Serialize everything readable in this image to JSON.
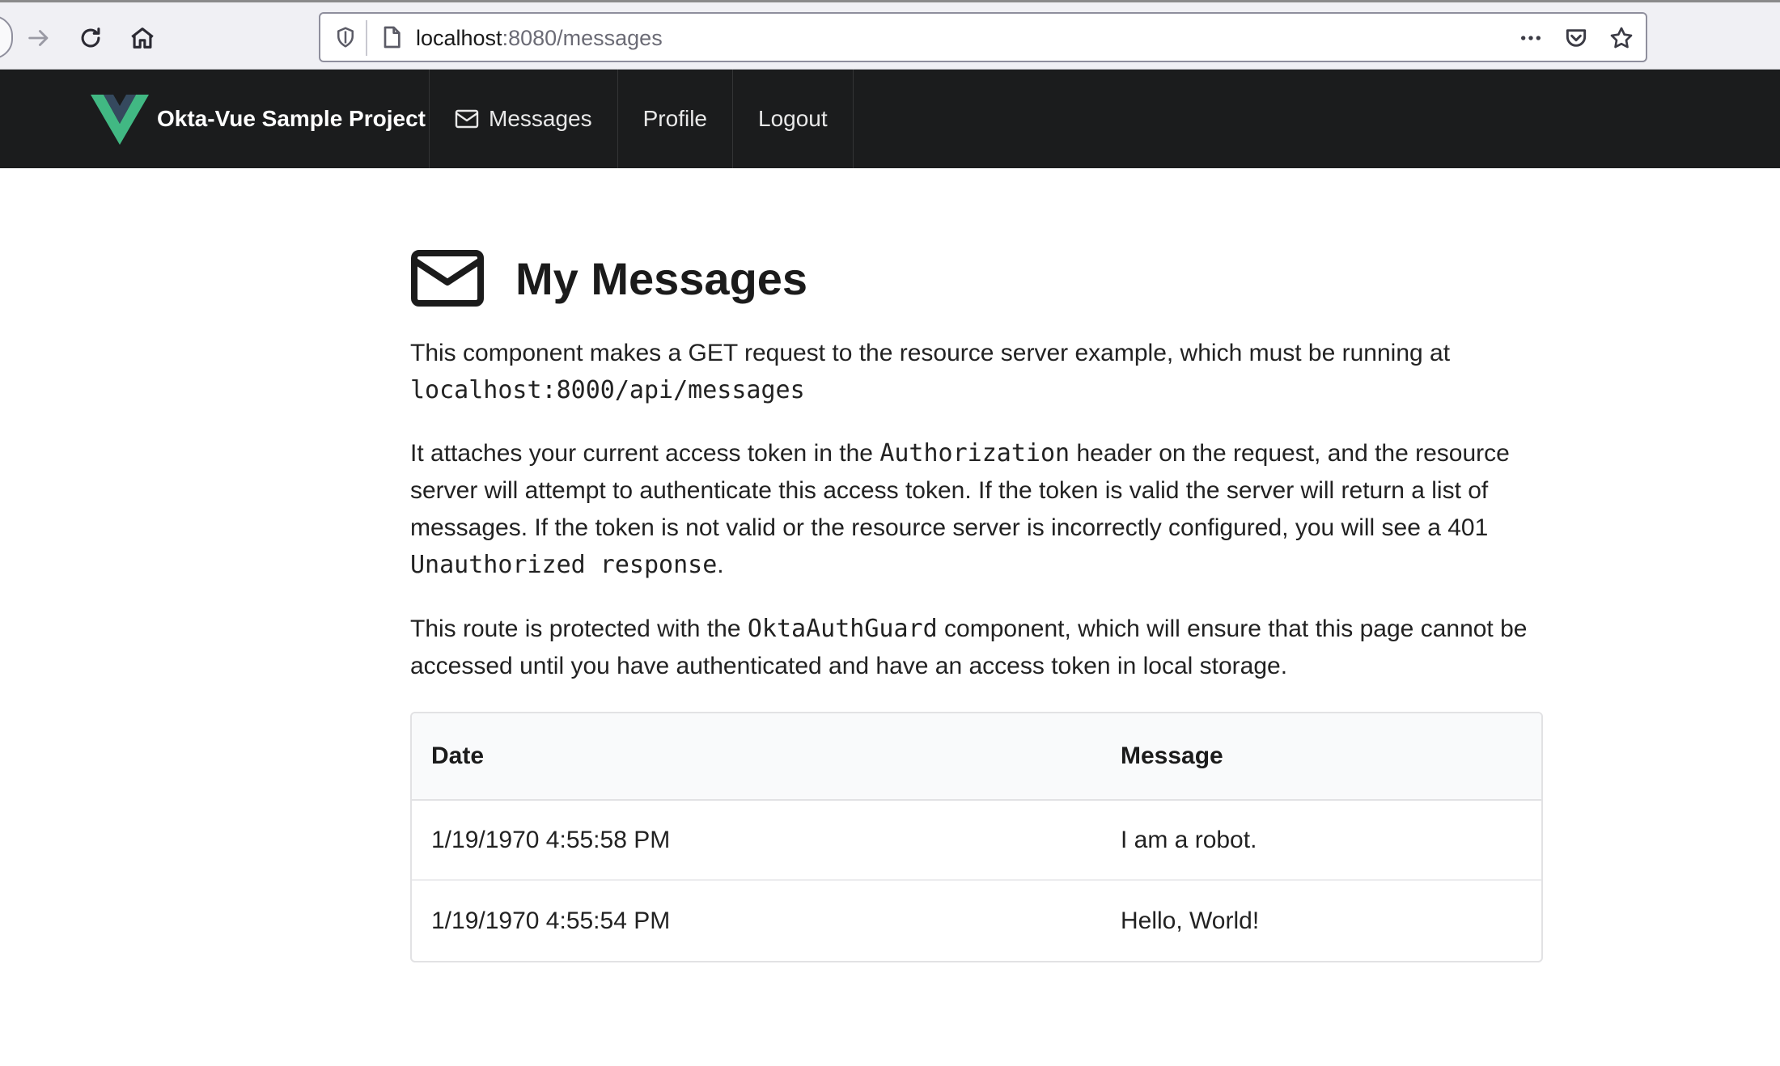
{
  "browser": {
    "url_host": "localhost",
    "url_rest": ":8080/messages"
  },
  "navbar": {
    "brand": "Okta-Vue Sample Project",
    "items": [
      {
        "label": "Messages",
        "icon": "envelope-icon"
      },
      {
        "label": "Profile"
      },
      {
        "label": "Logout"
      }
    ]
  },
  "main": {
    "title": "My Messages",
    "paragraph1": {
      "text": "This component makes a GET request to the resource server example, which must be running at",
      "code": "localhost:8000/api/messages"
    },
    "paragraph2": {
      "before": "It attaches your current access token in the",
      "code1": "Authorization",
      "middle": "header on the request, and the resource server will attempt to authenticate this access token. If the token is valid the server will return a list of messages. If the token is not valid or the resource server is incorrectly configured, you will see a 401",
      "code2": "Unauthorized response",
      "after": "."
    },
    "paragraph3": {
      "before": "This route is protected with the",
      "code": "OktaAuthGuard",
      "after": "component, which will ensure that this page cannot be accessed until you have authenticated and have an access token in local storage."
    },
    "table": {
      "headers": [
        "Date",
        "Message"
      ],
      "rows": [
        [
          "1/19/1970 4:55:58 PM",
          "I am a robot."
        ],
        [
          "1/19/1970 4:55:54 PM",
          "Hello, World!"
        ]
      ]
    }
  },
  "colors": {
    "navbar_bg": "#1b1c1d",
    "vue_green": "#41b883",
    "vue_dark": "#35495e"
  }
}
